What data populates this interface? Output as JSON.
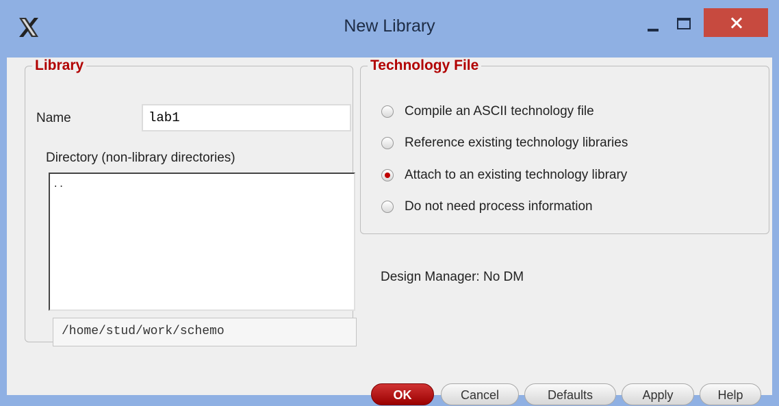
{
  "window": {
    "title": "New Library",
    "accent_title_bar": "#8fb0e3",
    "close_color": "#c74a3f"
  },
  "library_group": {
    "legend": "Library",
    "name_label": "Name",
    "name_value": "lab1",
    "directory_label": "Directory (non-library directories)",
    "directory_items": [
      ".."
    ],
    "path": "/home/stud/work/schemo"
  },
  "tech_group": {
    "legend": "Technology File",
    "options": [
      {
        "label": "Compile an ASCII technology file",
        "selected": false
      },
      {
        "label": "Reference existing technology libraries",
        "selected": false
      },
      {
        "label": "Attach to an existing technology library",
        "selected": true
      },
      {
        "label": "Do not need process information",
        "selected": false
      }
    ]
  },
  "design_manager": "Design Manager: No DM",
  "buttons": {
    "ok": "OK",
    "cancel": "Cancel",
    "defaults": "Defaults",
    "apply": "Apply",
    "help": "Help"
  }
}
